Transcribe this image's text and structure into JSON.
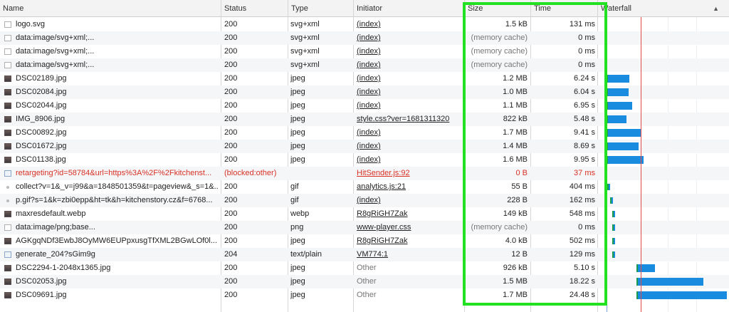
{
  "columns": {
    "name": "Name",
    "status": "Status",
    "type": "Type",
    "initiator": "Initiator",
    "size": "Size",
    "time": "Time",
    "waterfall": "Waterfall"
  },
  "sort_icon": "triangle-up-icon",
  "rows": [
    {
      "name": "logo.svg",
      "status": "200",
      "type": "svg+xml",
      "initiator": "(index)",
      "size": "1.5 kB",
      "time": "131 ms",
      "icon": "doc",
      "initiator_link": true,
      "size_muted": false,
      "blocked": false,
      "waterfall": null
    },
    {
      "name": "data:image/svg+xml;...",
      "status": "200",
      "type": "svg+xml",
      "initiator": "(index)",
      "size": "(memory cache)",
      "time": "0 ms",
      "icon": "doc",
      "initiator_link": true,
      "size_muted": true,
      "blocked": false,
      "waterfall": null
    },
    {
      "name": "data:image/svg+xml;...",
      "status": "200",
      "type": "svg+xml",
      "initiator": "(index)",
      "size": "(memory cache)",
      "time": "0 ms",
      "icon": "doc",
      "initiator_link": true,
      "size_muted": true,
      "blocked": false,
      "waterfall": null
    },
    {
      "name": "data:image/svg+xml;...",
      "status": "200",
      "type": "svg+xml",
      "initiator": "(index)",
      "size": "(memory cache)",
      "time": "0 ms",
      "icon": "doc",
      "initiator_link": true,
      "size_muted": true,
      "blocked": false,
      "waterfall": null
    },
    {
      "name": "DSC02189.jpg",
      "status": "200",
      "type": "jpeg",
      "initiator": "(index)",
      "size": "1.2 MB",
      "time": "6.24 s",
      "icon": "img",
      "initiator_link": true,
      "size_muted": false,
      "blocked": false,
      "waterfall": {
        "start_s": 0.0,
        "wait_s": 0.1,
        "end_s": 6.24
      }
    },
    {
      "name": "DSC02084.jpg",
      "status": "200",
      "type": "jpeg",
      "initiator": "(index)",
      "size": "1.0 MB",
      "time": "6.04 s",
      "icon": "img",
      "initiator_link": true,
      "size_muted": false,
      "blocked": false,
      "waterfall": {
        "start_s": 0.0,
        "wait_s": 0.1,
        "end_s": 6.04
      }
    },
    {
      "name": "DSC02044.jpg",
      "status": "200",
      "type": "jpeg",
      "initiator": "(index)",
      "size": "1.1 MB",
      "time": "6.95 s",
      "icon": "img",
      "initiator_link": true,
      "size_muted": false,
      "blocked": false,
      "waterfall": {
        "start_s": 0.0,
        "wait_s": 0.1,
        "end_s": 6.95
      }
    },
    {
      "name": "IMG_8906.jpg",
      "status": "200",
      "type": "jpeg",
      "initiator": "style.css?ver=1681311320",
      "size": "822 kB",
      "time": "5.48 s",
      "icon": "img",
      "initiator_link": true,
      "size_muted": false,
      "blocked": false,
      "waterfall": {
        "start_s": 0.0,
        "wait_s": 0.1,
        "end_s": 5.48
      }
    },
    {
      "name": "DSC00892.jpg",
      "status": "200",
      "type": "jpeg",
      "initiator": "(index)",
      "size": "1.7 MB",
      "time": "9.41 s",
      "icon": "img",
      "initiator_link": true,
      "size_muted": false,
      "blocked": false,
      "waterfall": {
        "start_s": 0.0,
        "wait_s": 0.1,
        "end_s": 9.41
      }
    },
    {
      "name": "DSC01672.jpg",
      "status": "200",
      "type": "jpeg",
      "initiator": "(index)",
      "size": "1.4 MB",
      "time": "8.69 s",
      "icon": "img",
      "initiator_link": true,
      "size_muted": false,
      "blocked": false,
      "waterfall": {
        "start_s": 0.0,
        "wait_s": 0.1,
        "end_s": 8.69
      }
    },
    {
      "name": "DSC01138.jpg",
      "status": "200",
      "type": "jpeg",
      "initiator": "(index)",
      "size": "1.6 MB",
      "time": "9.95 s",
      "icon": "img",
      "initiator_link": true,
      "size_muted": false,
      "blocked": false,
      "waterfall": {
        "start_s": 0.0,
        "wait_s": 0.1,
        "end_s": 9.95
      }
    },
    {
      "name": "retargeting?id=58784&url=https%3A%2F%2Fkitchenst...",
      "status": "(blocked:other)",
      "type": "",
      "initiator": "HitSender.js:92",
      "size": "0 B",
      "time": "37 ms",
      "icon": "page",
      "initiator_link": true,
      "size_muted": false,
      "blocked": true,
      "waterfall": null
    },
    {
      "name": "collect?v=1&_v=j99&a=1848501359&t=pageview&_s=1&...",
      "status": "200",
      "type": "gif",
      "initiator": "analytics.js:21",
      "size": "55 B",
      "time": "404 ms",
      "icon": "dot",
      "initiator_link": true,
      "size_muted": false,
      "blocked": false,
      "waterfall": {
        "start_s": 0.1,
        "wait_s": 0.3,
        "end_s": 0.5
      }
    },
    {
      "name": "p.gif?s=1&k=zbi0epp&ht=tk&h=kitchenstory.cz&f=6768...",
      "status": "200",
      "type": "gif",
      "initiator": "(index)",
      "size": "228 B",
      "time": "162 ms",
      "icon": "dot",
      "initiator_link": true,
      "size_muted": false,
      "blocked": false,
      "waterfall": {
        "start_s": 1.0,
        "wait_s": 0.1,
        "end_s": 1.3
      }
    },
    {
      "name": "maxresdefault.webp",
      "status": "200",
      "type": "webp",
      "initiator": "R8gRiGH7Zak",
      "size": "149 kB",
      "time": "548 ms",
      "icon": "img",
      "initiator_link": true,
      "size_muted": false,
      "blocked": false,
      "waterfall": {
        "start_s": 1.6,
        "wait_s": 0.3,
        "end_s": 2.3
      }
    },
    {
      "name": "data:image/png;base...",
      "status": "200",
      "type": "png",
      "initiator": "www-player.css",
      "size": "(memory cache)",
      "time": "0 ms",
      "icon": "doc",
      "initiator_link": true,
      "size_muted": true,
      "blocked": false,
      "waterfall": {
        "start_s": 1.5,
        "wait_s": 0.0,
        "end_s": 1.6
      }
    },
    {
      "name": "AGKgqNDf3EwbJ8OyMW6EUPpxusgTfXML2BGwLOf0l...",
      "status": "200",
      "type": "jpeg",
      "initiator": "R8gRiGH7Zak",
      "size": "4.0 kB",
      "time": "502 ms",
      "icon": "img",
      "initiator_link": true,
      "size_muted": false,
      "blocked": false,
      "waterfall": {
        "start_s": 1.6,
        "wait_s": 0.3,
        "end_s": 2.2
      }
    },
    {
      "name": "generate_204?sGim9g",
      "status": "204",
      "type": "text/plain",
      "initiator": "VM774:1",
      "size": "12 B",
      "time": "129 ms",
      "icon": "page",
      "initiator_link": true,
      "size_muted": false,
      "blocked": false,
      "waterfall": {
        "start_s": 1.6,
        "wait_s": 0.0,
        "end_s": 1.8
      }
    },
    {
      "name": "DSC2294-1-2048x1365.jpg",
      "status": "200",
      "type": "jpeg",
      "initiator": "Other",
      "size": "926 kB",
      "time": "5.10 s",
      "icon": "img",
      "initiator_link": false,
      "size_muted": false,
      "blocked": false,
      "waterfall": {
        "start_s": 8.0,
        "wait_s": 0.5,
        "end_s": 13.1
      }
    },
    {
      "name": "DSC02053.jpg",
      "status": "200",
      "type": "jpeg",
      "initiator": "Other",
      "size": "1.5 MB",
      "time": "18.22 s",
      "icon": "img",
      "initiator_link": false,
      "size_muted": false,
      "blocked": false,
      "waterfall": {
        "start_s": 8.0,
        "wait_s": 0.5,
        "end_s": 26.2
      }
    },
    {
      "name": "DSC09691.jpg",
      "status": "200",
      "type": "jpeg",
      "initiator": "Other",
      "size": "1.7 MB",
      "time": "24.48 s",
      "icon": "img",
      "initiator_link": false,
      "size_muted": false,
      "blocked": false,
      "waterfall": {
        "start_s": 8.0,
        "wait_s": 0.5,
        "end_s": 32.5
      }
    }
  ],
  "colors": {
    "highlight": "#22e022",
    "waiting": "#1a9a4a",
    "download": "#1a8ce0",
    "blocked_text": "#d93025",
    "load_event": "#e04b4b",
    "dom_content_loaded": "#4a7bd0"
  }
}
